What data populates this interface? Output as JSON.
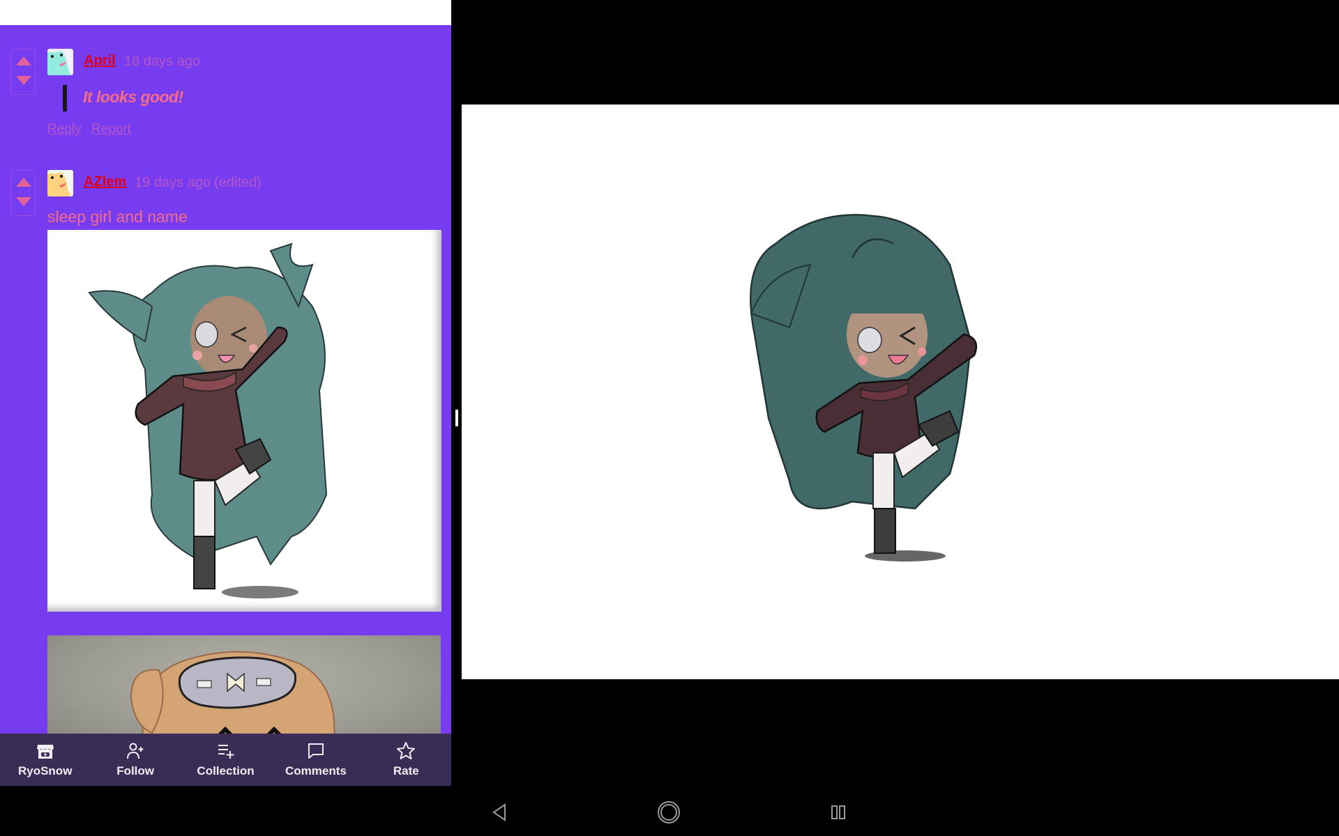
{
  "comments": [
    {
      "author": "April",
      "time": "18 days ago",
      "edited": "",
      "quote": "It looks good!",
      "actions": [
        "Reply",
        "Report"
      ],
      "avatar_color": "#93ecdf"
    },
    {
      "author": "AZlem",
      "time": "19 days ago",
      "edited": "(edited)",
      "text": "sleep girl and name",
      "avatar_color": "#ffd27f",
      "images": [
        "gacha-character-teal-hair",
        "gacha-character-sleep-mask"
      ]
    }
  ],
  "bottom_bar": [
    {
      "label": "RyoSnow",
      "icon": "itchio-store-icon"
    },
    {
      "label": "Follow",
      "icon": "user-plus-icon"
    },
    {
      "label": "Collection",
      "icon": "playlist-add-icon"
    },
    {
      "label": "Comments",
      "icon": "comment-icon"
    },
    {
      "label": "Rate",
      "icon": "star-icon"
    }
  ],
  "viewer": {
    "image": "gacha-character-teal-hair"
  },
  "system_nav": [
    "back",
    "home",
    "recents"
  ],
  "colors": {
    "panel_bg": "#773bf0",
    "author_link": "#e00016",
    "comment_text": "#f36c8a",
    "meta_text": "#b556c9",
    "bottom_bar_bg": "#3a2d55"
  }
}
